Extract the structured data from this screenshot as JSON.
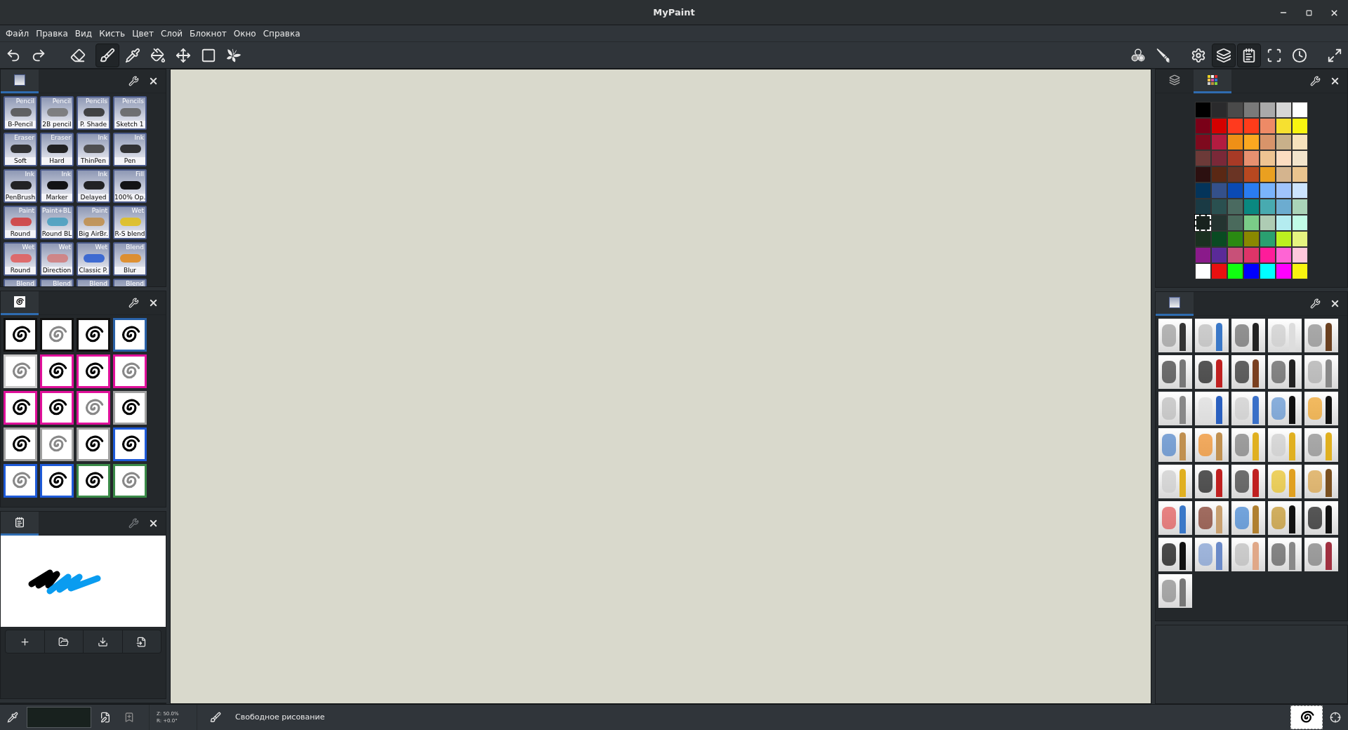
{
  "window": {
    "title": "MyPaint"
  },
  "menu": [
    "Файл",
    "Правка",
    "Вид",
    "Кисть",
    "Цвет",
    "Слой",
    "Блокнот",
    "Окно",
    "Справка"
  ],
  "toolbar_left": [
    {
      "kind": "undo",
      "active": false
    },
    {
      "kind": "redo",
      "active": false
    },
    {
      "kind": "eraser",
      "active": false
    },
    {
      "kind": "brush",
      "active": true
    },
    {
      "kind": "picker",
      "active": false
    },
    {
      "kind": "fill",
      "active": false
    },
    {
      "kind": "move",
      "active": false
    },
    {
      "kind": "frame",
      "active": false
    },
    {
      "kind": "symmetry",
      "active": false
    }
  ],
  "toolbar_right": [
    {
      "kind": "colors",
      "active": false
    },
    {
      "kind": "brushes",
      "active": false
    },
    {
      "kind": "settings",
      "active": false
    },
    {
      "kind": "layers",
      "active": true
    },
    {
      "kind": "scratchpad",
      "active": true
    },
    {
      "kind": "fullscreen",
      "active": false
    },
    {
      "kind": "history",
      "active": false
    },
    {
      "kind": "expand",
      "active": false
    }
  ],
  "brush_group_panel": {
    "settings_disabled": false,
    "tabs": [
      {
        "kind": "brushes",
        "selected": true
      }
    ],
    "brushes": [
      {
        "category": "Pencil",
        "name": "B-Pencil"
      },
      {
        "category": "Pencil",
        "name": "2B pencil"
      },
      {
        "category": "Pencils",
        "name": "P. Shade"
      },
      {
        "category": "Pencils",
        "name": "Sketch 1"
      },
      {
        "category": "Eraser",
        "name": "Soft"
      },
      {
        "category": "Eraser",
        "name": "Hard"
      },
      {
        "category": "Ink",
        "name": "ThinPen"
      },
      {
        "category": "Ink",
        "name": "Pen"
      },
      {
        "category": "Ink",
        "name": "PenBrush"
      },
      {
        "category": "Ink",
        "name": "Marker"
      },
      {
        "category": "Ink",
        "name": "Delayed"
      },
      {
        "category": "Fill",
        "name": "100% Op."
      },
      {
        "category": "Paint",
        "name": "Round"
      },
      {
        "category": "Paint+BL",
        "name": "Round BL"
      },
      {
        "category": "Paint",
        "name": "Big AirBr."
      },
      {
        "category": "Wet",
        "name": "R-S blend"
      },
      {
        "category": "Wet",
        "name": "Round"
      },
      {
        "category": "Wet",
        "name": "Direction"
      },
      {
        "category": "Wet",
        "name": "Classic P."
      },
      {
        "category": "Blend",
        "name": "Blur"
      },
      {
        "category": "Blend"
      },
      {
        "category": "Blend"
      },
      {
        "category": "Blend"
      },
      {
        "category": "Blend"
      }
    ]
  },
  "brush_shapes_panel": {
    "settings_disabled": false,
    "tabs": [
      {
        "kind": "shapes",
        "selected": true
      }
    ],
    "shapes": [
      {
        "color": "#111111"
      },
      {
        "color": "#111111"
      },
      {
        "color": "#111111"
      },
      {
        "color": "#2a62a8"
      },
      {
        "color": "#c8c8c8"
      },
      {
        "color": "#e0109a"
      },
      {
        "color": "#e0109a"
      },
      {
        "color": "#e0109a"
      },
      {
        "color": "#e0109a"
      },
      {
        "color": "#e0109a"
      },
      {
        "color": "#e0109a"
      },
      {
        "color": "#a0a0a0"
      },
      {
        "color": "#a0a0a0"
      },
      {
        "color": "#a0a0a0"
      },
      {
        "color": "#a0a0a0"
      },
      {
        "color": "#1e5ad8"
      },
      {
        "color": "#1e5ad8"
      },
      {
        "color": "#1e5ad8"
      },
      {
        "color": "#3a8a48"
      },
      {
        "color": "#3a8a48"
      }
    ]
  },
  "scratchpad_panel": {
    "settings_disabled": true,
    "tabs": [
      {
        "kind": "scratchpad",
        "selected": true
      }
    ],
    "buttons": [
      {
        "kind": "new"
      },
      {
        "kind": "open"
      },
      {
        "kind": "save"
      },
      {
        "kind": "revert"
      }
    ]
  },
  "palette_panel": {
    "settings_disabled": false,
    "tabs": [
      {
        "kind": "layers",
        "selected": false
      },
      {
        "kind": "palette",
        "selected": true
      }
    ],
    "colors": [
      {
        "color": "#000000",
        "selected": false
      },
      {
        "color": "#2a2a2c",
        "selected": false
      },
      {
        "color": "#4a4a4a",
        "selected": false
      },
      {
        "color": "#7a7a7a",
        "selected": false
      },
      {
        "color": "#aaaaaa",
        "selected": false
      },
      {
        "color": "#d6d6d6",
        "selected": false
      },
      {
        "color": "#ffffff",
        "selected": false
      },
      {
        "color": "#7a0018",
        "selected": false
      },
      {
        "color": "#d40000",
        "selected": false
      },
      {
        "color": "#ff3a1e",
        "selected": false
      },
      {
        "color": "#ff3c1a",
        "selected": false
      },
      {
        "color": "#ee8a66",
        "selected": false
      },
      {
        "color": "#f6e030",
        "selected": false
      },
      {
        "color": "#f8f410",
        "selected": false
      },
      {
        "color": "#7e0a1e",
        "selected": false
      },
      {
        "color": "#b21c40",
        "selected": false
      },
      {
        "color": "#ee9016",
        "selected": false
      },
      {
        "color": "#fca820",
        "selected": false
      },
      {
        "color": "#d8946a",
        "selected": false
      },
      {
        "color": "#c8b08a",
        "selected": false
      },
      {
        "color": "#f6e2bc",
        "selected": false
      },
      {
        "color": "#6c3a38",
        "selected": false
      },
      {
        "color": "#7a2838",
        "selected": false
      },
      {
        "color": "#a83a26",
        "selected": false
      },
      {
        "color": "#e89070",
        "selected": false
      },
      {
        "color": "#eec492",
        "selected": false
      },
      {
        "color": "#fcdcc0",
        "selected": false
      },
      {
        "color": "#f2e4cc",
        "selected": false
      },
      {
        "color": "#2c1010",
        "selected": false
      },
      {
        "color": "#5a2814",
        "selected": false
      },
      {
        "color": "#6a3424",
        "selected": false
      },
      {
        "color": "#b84820",
        "selected": false
      },
      {
        "color": "#eaa020",
        "selected": false
      },
      {
        "color": "#d4b48e",
        "selected": false
      },
      {
        "color": "#eac48e",
        "selected": false
      },
      {
        "color": "#04345a",
        "selected": false
      },
      {
        "color": "#34508a",
        "selected": false
      },
      {
        "color": "#0a4ab4",
        "selected": false
      },
      {
        "color": "#2a7cf0",
        "selected": false
      },
      {
        "color": "#7ab4fc",
        "selected": false
      },
      {
        "color": "#a0c4fc",
        "selected": false
      },
      {
        "color": "#cce4fe",
        "selected": false
      },
      {
        "color": "#1a3a44",
        "selected": false
      },
      {
        "color": "#2a5050",
        "selected": false
      },
      {
        "color": "#4a6a60",
        "selected": false
      },
      {
        "color": "#0a8880",
        "selected": false
      },
      {
        "color": "#48aab0",
        "selected": false
      },
      {
        "color": "#6cacd0",
        "selected": false
      },
      {
        "color": "#aad4b8",
        "selected": false
      },
      {
        "color": "#18221e",
        "selected": true
      },
      {
        "color": "#243430",
        "selected": false
      },
      {
        "color": "#4a6a5c",
        "selected": false
      },
      {
        "color": "#7acc88",
        "selected": false
      },
      {
        "color": "#aeccb4",
        "selected": false
      },
      {
        "color": "#b4ecf0",
        "selected": false
      },
      {
        "color": "#c0fce6",
        "selected": false
      },
      {
        "color": "#1a3020",
        "selected": false
      },
      {
        "color": "#0a4a22",
        "selected": false
      },
      {
        "color": "#2a8a12",
        "selected": false
      },
      {
        "color": "#8a8800",
        "selected": false
      },
      {
        "color": "#2aa070",
        "selected": false
      },
      {
        "color": "#bcf020",
        "selected": false
      },
      {
        "color": "#e6f480",
        "selected": false
      },
      {
        "color": "#8a1a8a",
        "selected": false
      },
      {
        "color": "#5a2a98",
        "selected": false
      },
      {
        "color": "#c85078",
        "selected": false
      },
      {
        "color": "#de3468",
        "selected": false
      },
      {
        "color": "#fe1c9a",
        "selected": false
      },
      {
        "color": "#fe64d4",
        "selected": false
      },
      {
        "color": "#ffc8dc",
        "selected": false
      },
      {
        "color": "#ffffff",
        "selected": false
      },
      {
        "color": "#e81010",
        "selected": false
      },
      {
        "color": "#10ff10",
        "selected": false
      },
      {
        "color": "#0000ff",
        "selected": false
      },
      {
        "color": "#00ffff",
        "selected": false
      },
      {
        "color": "#ff00ff",
        "selected": false
      },
      {
        "color": "#f8f410",
        "selected": false
      }
    ]
  },
  "brushes_panel": {
    "settings_disabled": false,
    "tabs": [
      {
        "kind": "brushes",
        "selected": true
      }
    ]
  },
  "status_bar": {
    "color": "#18211e",
    "zoom": "Z: 50.0%",
    "rotation": "R: +0.0°",
    "mode": "Свободное рисование"
  }
}
